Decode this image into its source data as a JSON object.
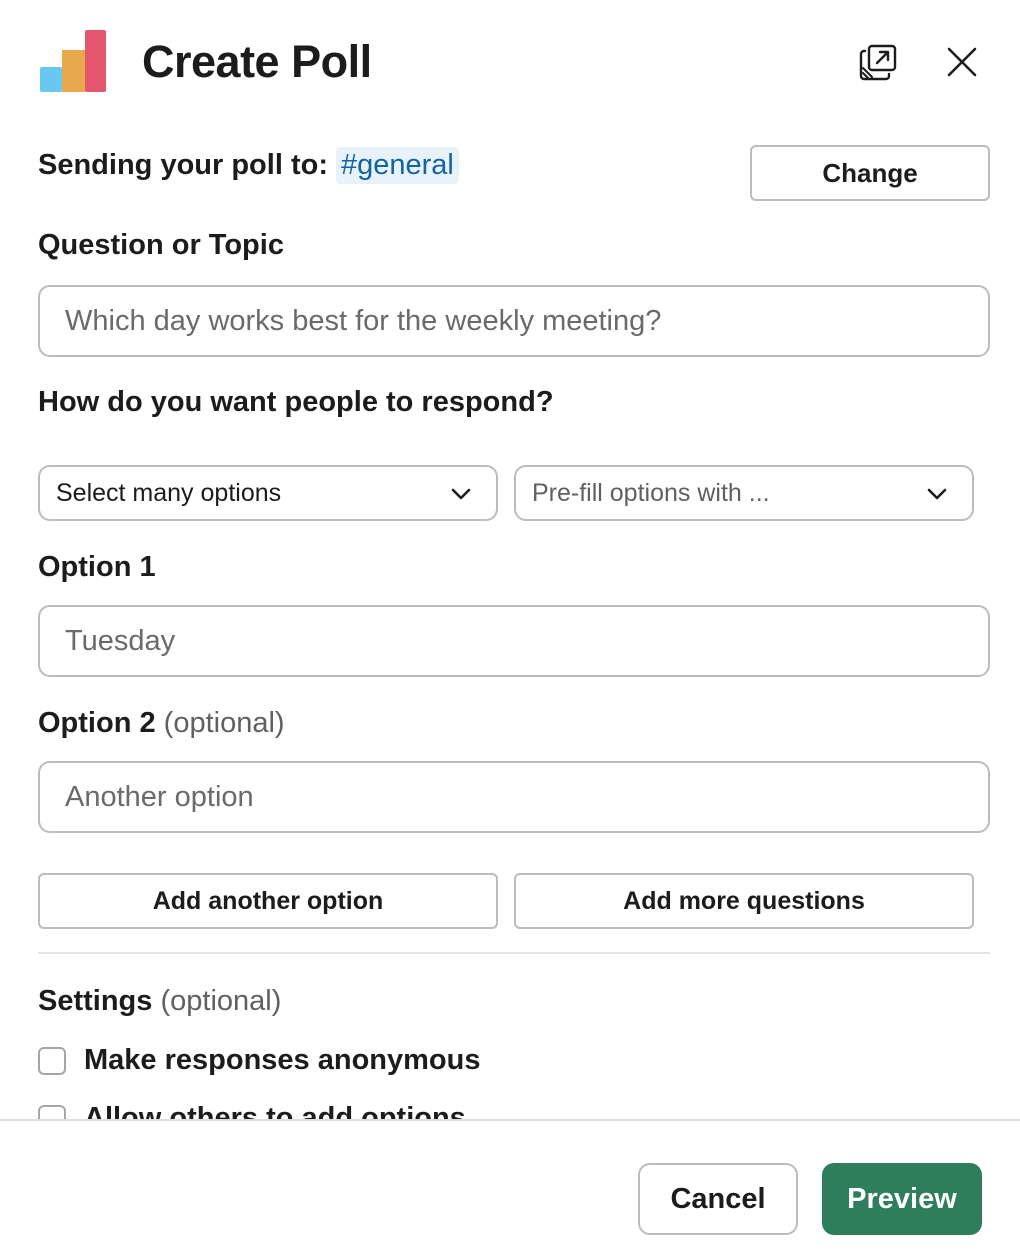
{
  "header": {
    "title": "Create Poll",
    "logo_icon": "bar-chart-logo",
    "popout_icon": "popout-windows-icon",
    "close_icon": "close-icon",
    "logo_colors": [
      "#69c8f2",
      "#e9a84c",
      "#e5566f"
    ]
  },
  "sending": {
    "label": "Sending your poll to:",
    "channel": "#general",
    "change_label": "Change"
  },
  "question": {
    "label": "Question or Topic",
    "placeholder": "Which day works best for the weekly meeting?"
  },
  "respond": {
    "label": "How do you want people to respond?",
    "response_type": "Select many options",
    "prefill_placeholder": "Pre-fill options with ..."
  },
  "option1": {
    "label": "Option 1",
    "placeholder": "Tuesday"
  },
  "option2": {
    "label": "Option 2",
    "optional": "(optional)",
    "placeholder": "Another option"
  },
  "actions": {
    "add_option": "Add another option",
    "add_questions": "Add more questions"
  },
  "settings": {
    "label": "Settings",
    "optional": "(optional)",
    "items": [
      {
        "label": "Make responses anonymous",
        "checked": false
      },
      {
        "label": "Allow others to add options",
        "checked": false
      }
    ]
  },
  "footer": {
    "cancel_label": "Cancel",
    "preview_label": "Preview",
    "preview_color": "#2e7d5c"
  }
}
